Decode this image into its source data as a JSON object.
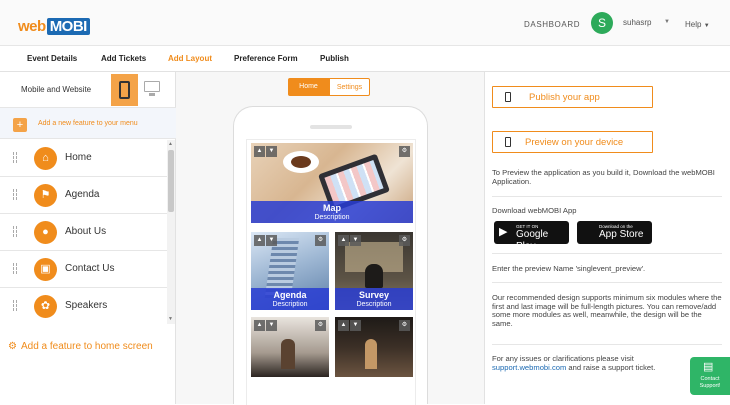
{
  "header": {
    "logo_web": "web",
    "logo_mobi": "MOBI",
    "dashboard": "DASHBOARD",
    "avatar_letter": "S",
    "username": "suhasrp",
    "help": "Help"
  },
  "nav": {
    "tabs": [
      {
        "label": "Event Details",
        "active": false
      },
      {
        "label": "Add Tickets",
        "active": false
      },
      {
        "label": "Add Layout",
        "active": true
      },
      {
        "label": "Preference Form",
        "active": false
      },
      {
        "label": "Publish",
        "active": false
      }
    ]
  },
  "left": {
    "mode_label": "Mobile and Website",
    "add_feature_menu": "Add a new feature to your menu",
    "features": [
      {
        "label": "Home",
        "icon": "home-icon"
      },
      {
        "label": "Agenda",
        "icon": "flag-icon"
      },
      {
        "label": "About Us",
        "icon": "chat-bubble-icon"
      },
      {
        "label": "Contact Us",
        "icon": "contact-card-icon"
      },
      {
        "label": "Speakers",
        "icon": "speaker-person-icon"
      }
    ],
    "add_home_feature": "Add a feature to home screen"
  },
  "center": {
    "seg_home": "Home",
    "seg_settings": "Settings",
    "tiles": [
      {
        "title": "Map",
        "desc": "Description"
      },
      {
        "title": "Agenda",
        "desc": "Description"
      },
      {
        "title": "Survey",
        "desc": "Description"
      }
    ]
  },
  "right": {
    "publish_btn": "Publish your app",
    "preview_btn": "Preview on your device",
    "preview_info": "To Preview the application as you build it, Download the webMOBI Application.",
    "download_title": "Download webMOBI App",
    "google_small": "GET IT ON",
    "google_big": "Google Play",
    "apple_small": "Download on the",
    "apple_big": "App Store",
    "preview_name": "Enter the preview Name 'singlevent_preview'.",
    "design_note": "Our recommended design supports minimum six modules where the first and last image will be full-length pictures. You can remove/add some more modules as well, meanwhile, the design will be the same.",
    "support_pre": "For any issues or clarifications please visit ",
    "support_link": "support.webmobi.com",
    "support_post": " and raise a support ticket."
  },
  "contact": {
    "label": "Contact Support!"
  },
  "colors": {
    "accent": "#f08c1c",
    "brand_blue": "#1c6ab3",
    "avatar_green": "#2daa5a",
    "caption_blue": "#2838d2"
  }
}
